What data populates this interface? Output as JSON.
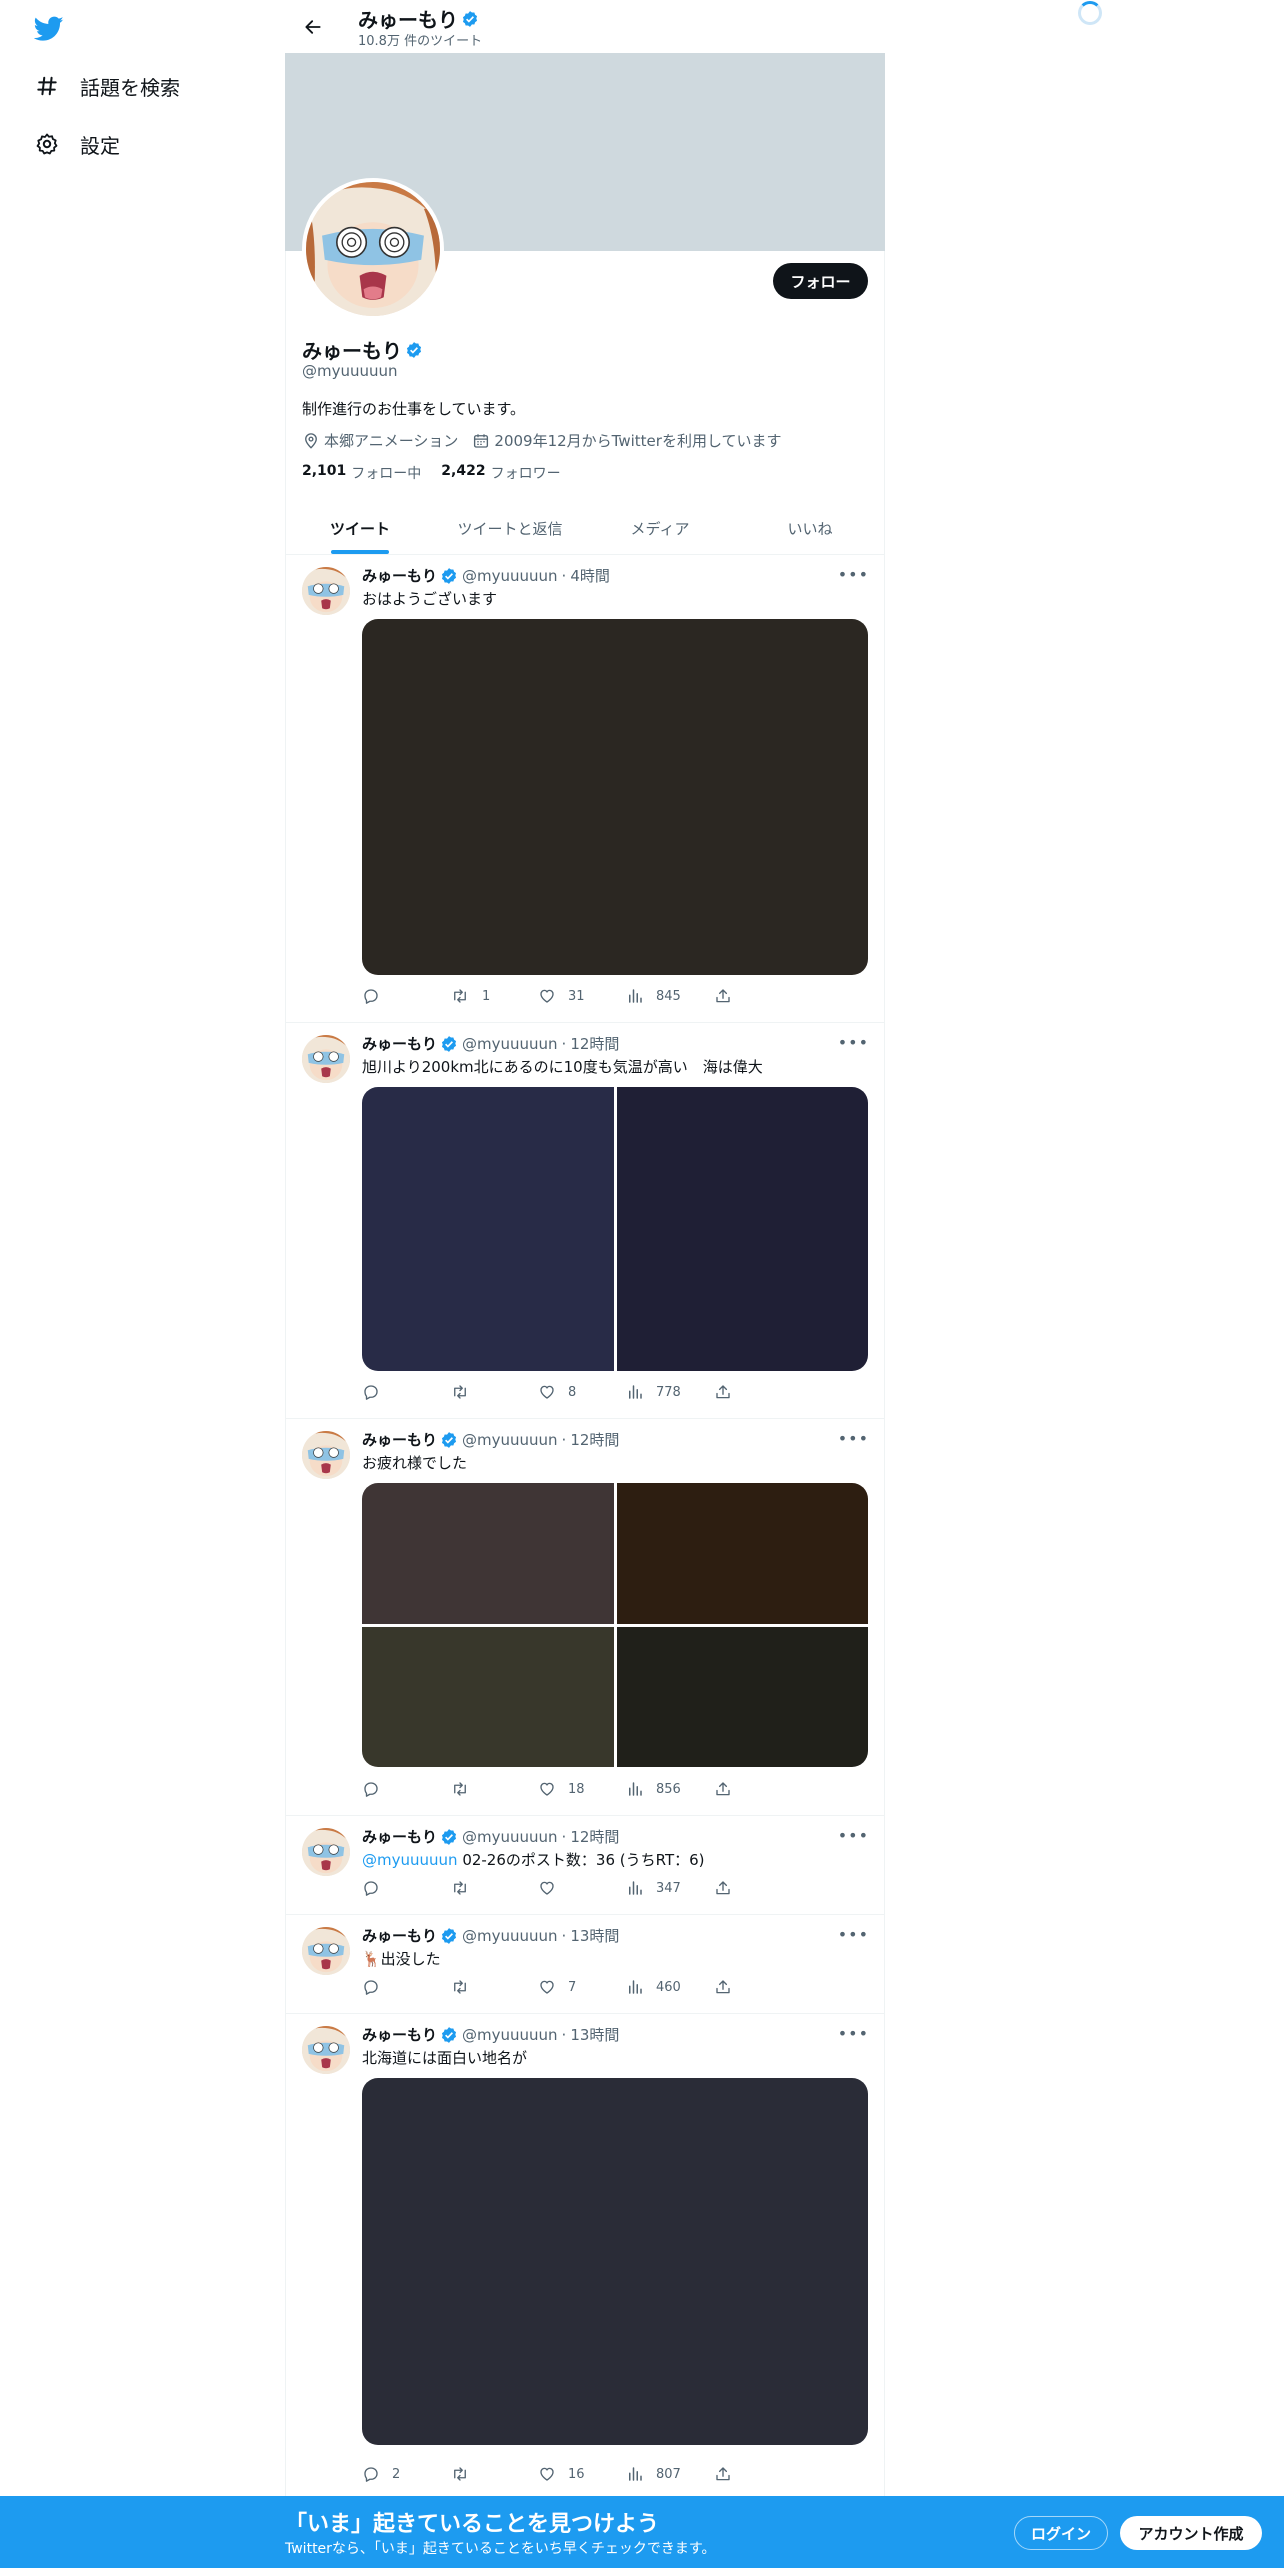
{
  "nav": {
    "logo_icon": "twitter-bird-icon",
    "items": [
      {
        "label": "話題を検索",
        "icon": "hashtag-icon"
      },
      {
        "label": "設定",
        "icon": "gear-icon"
      }
    ]
  },
  "header": {
    "name": "みゅーもり",
    "tweet_count": "10.8万 件のツイート"
  },
  "profile": {
    "name": "みゅーもり",
    "handle": "@myuuuuun",
    "bio": "制作進行のお仕事をしています。",
    "location": "本郷アニメーション",
    "joined": "2009年12月からTwitterを利用しています",
    "following_count": "2,101",
    "following_label": "フォロー中",
    "followers_count": "2,422",
    "followers_label": "フォロワー",
    "follow_button": "フォロー"
  },
  "tabs": [
    {
      "label": "ツイート",
      "active": true
    },
    {
      "label": "ツイートと返信",
      "active": false
    },
    {
      "label": "メディア",
      "active": false
    },
    {
      "label": "いいね",
      "active": false
    }
  ],
  "tweets": [
    {
      "name": "みゅーもり",
      "handle": "@myuuuuun",
      "time": "4時間",
      "text": "おはようございます",
      "reply": "",
      "retweet": "1",
      "like": "31",
      "views": "845",
      "media_colors": [
        "#2b2722"
      ]
    },
    {
      "name": "みゅーもり",
      "handle": "@myuuuuun",
      "time": "12時間",
      "text": "旭川より200km北にあるのに10度も気温が高い　海は偉大",
      "reply": "",
      "retweet": "",
      "like": "8",
      "views": "778",
      "media_colors": [
        "#282b47",
        "#1f1f35"
      ]
    },
    {
      "name": "みゅーもり",
      "handle": "@myuuuuun",
      "time": "12時間",
      "text": "お疲れ様でした",
      "reply": "",
      "retweet": "",
      "like": "18",
      "views": "856",
      "media_colors": [
        "#3f3535",
        "#2d1e11",
        "#38372b",
        "#20201a"
      ]
    },
    {
      "name": "みゅーもり",
      "handle": "@myuuuuun",
      "time": "12時間",
      "mention": "@myuuuuun",
      "text": "02-26のポスト数：36 (うちRT：6)",
      "reply": "",
      "retweet": "",
      "like": "",
      "views": "347"
    },
    {
      "name": "みゅーもり",
      "handle": "@myuuuuun",
      "time": "13時間",
      "text": "🦌出没した",
      "reply": "",
      "retweet": "",
      "like": "7",
      "views": "460"
    },
    {
      "name": "みゅーもり",
      "handle": "@myuuuuun",
      "time": "13時間",
      "text": "北海道には面白い地名が",
      "reply": "2",
      "retweet": "",
      "like": "16",
      "views": "807",
      "media_colors": [
        "#2a2c37"
      ]
    }
  ],
  "bottom_bar": {
    "title": "「いま」起きていることを見つけよう",
    "subtitle": "Twitterなら、「いま」起きていることをいち早くチェックできます。",
    "login": "ログイン",
    "signup": "アカウント作成"
  },
  "colors": {
    "accent": "#1d9bf0",
    "banner": "#cfd9de",
    "text": "#0f1419",
    "muted": "#536471"
  }
}
